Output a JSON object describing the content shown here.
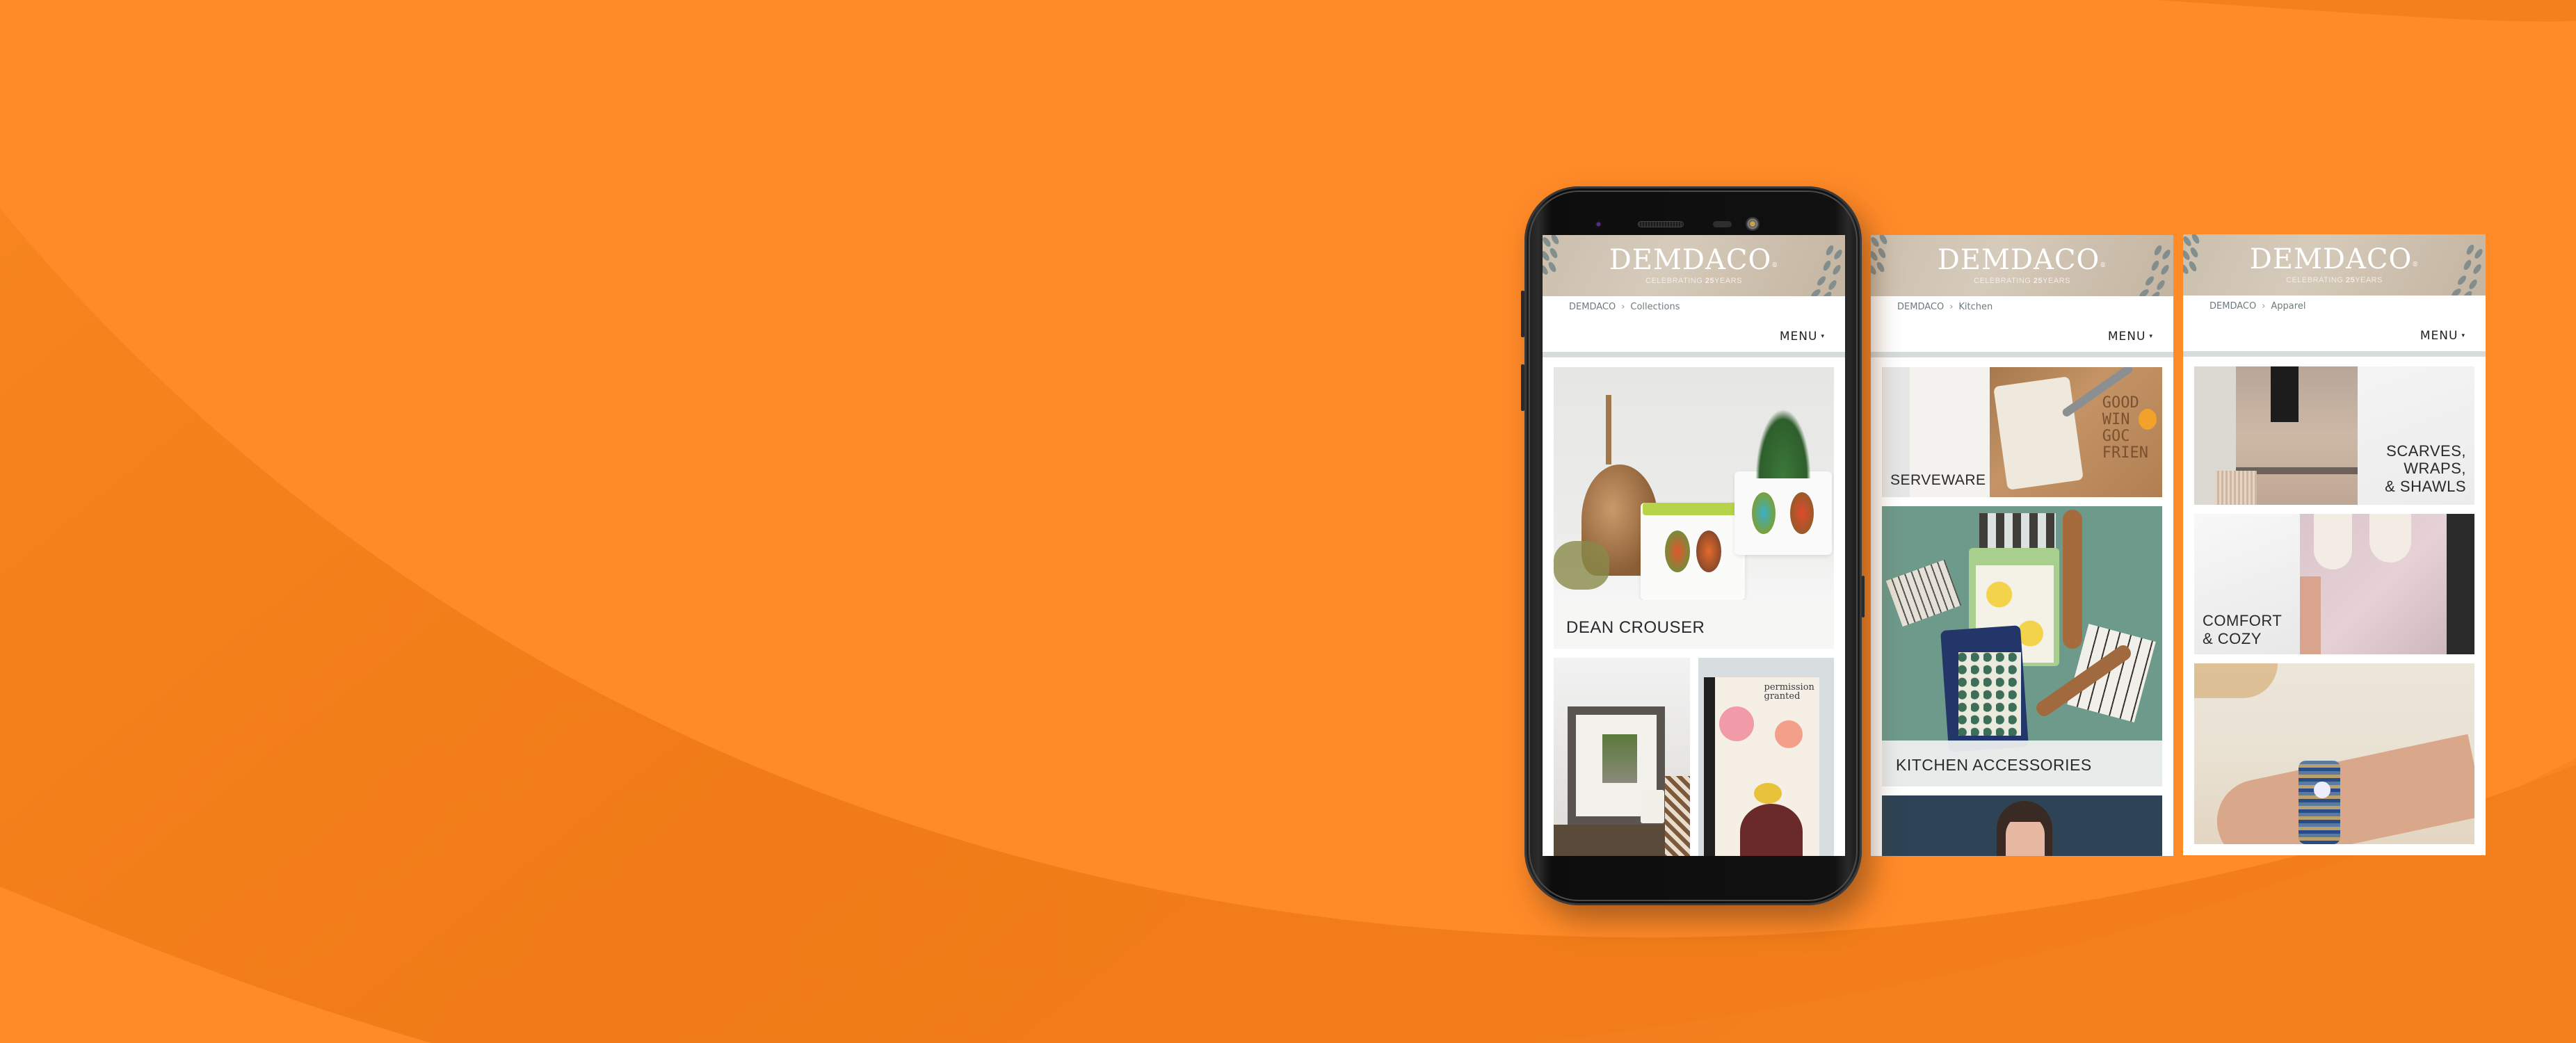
{
  "background": {
    "accent_color": "#ff8a28",
    "shade_color": "#f07a18"
  },
  "site": {
    "logo_text": "DEMDACO",
    "logo_mark": "®",
    "tagline_prefix": "CELEBRATING ",
    "tagline_number": "25",
    "tagline_suffix": "YEARS",
    "menu_label": "MENU",
    "menu_caret": "▾",
    "breadcrumb_separator": "›"
  },
  "screens": [
    {
      "device": "phone",
      "breadcrumb": [
        "DEMDACO",
        "Collections"
      ],
      "tiles": [
        {
          "label": "DEAN CROUSER",
          "image": "hummingbird ceramic planters with succulents"
        },
        {
          "label": "",
          "image": "framed photo print with mug"
        },
        {
          "label": "",
          "image": "floral 'permission granted' canvas art"
        }
      ]
    },
    {
      "device": "panel",
      "breadcrumb": [
        "DEMDACO",
        "Kitchen"
      ],
      "tiles": [
        {
          "label": "SERVEWARE",
          "image": "cutting board with crackers and spreader"
        },
        {
          "label": "KITCHEN ACCESSORIES",
          "image": "pot holders, towels and wooden spatulas"
        },
        {
          "label": "",
          "image": "smiling woman portrait"
        }
      ]
    },
    {
      "device": "panel",
      "breadcrumb": [
        "DEMDACO",
        "Apparel"
      ],
      "tiles": [
        {
          "label": "SCARVES,\nWRAPS,\n& SHAWLS",
          "label_lines": [
            "SCARVES,",
            "WRAPS,",
            "& SHAWLS"
          ],
          "image": "knit wrap with fringe"
        },
        {
          "label": "COMFORT & COZY",
          "label_lines": [
            "COMFORT",
            "& COZY"
          ],
          "image": "pink cable-knit slippers"
        },
        {
          "label": "",
          "image": "beaded bracelets on wrist"
        }
      ]
    }
  ]
}
